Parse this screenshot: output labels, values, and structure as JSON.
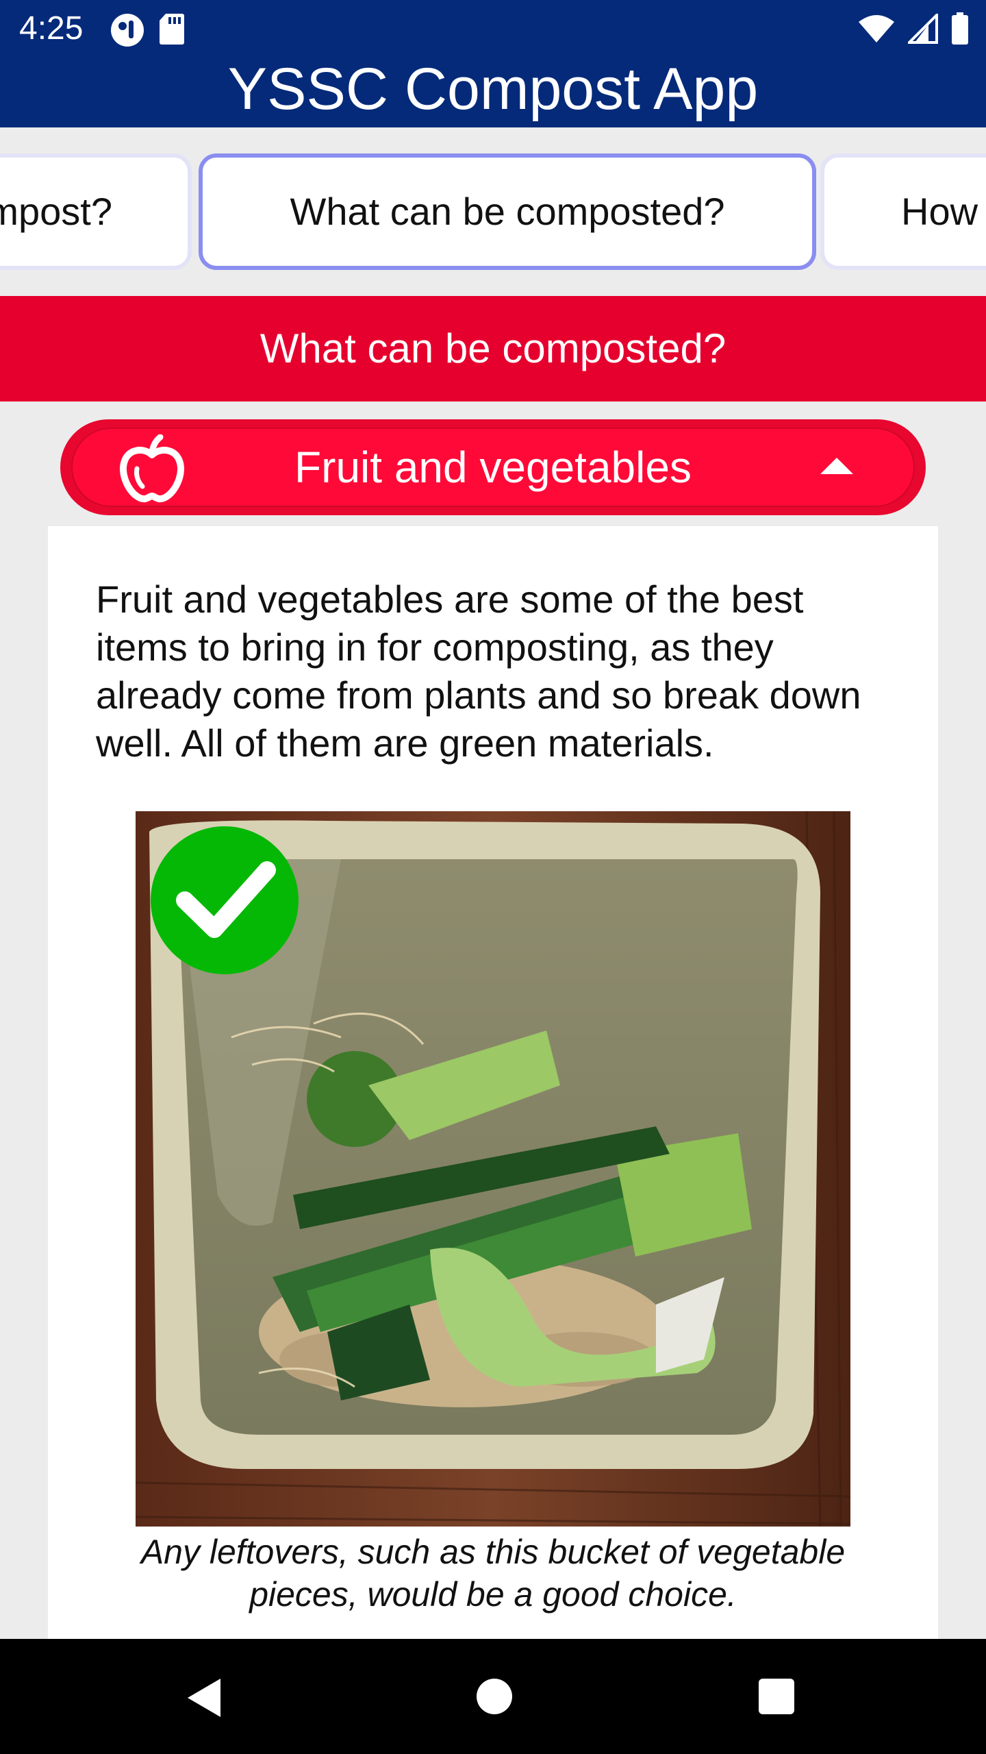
{
  "status_bar": {
    "time": "4:25",
    "icons_left": [
      "notification-icon",
      "sd-card-icon"
    ],
    "icons_right": [
      "wifi-icon",
      "cell-signal-icon",
      "battery-icon"
    ]
  },
  "app_bar": {
    "title": "YSSC Compost App",
    "color": "#052a7a"
  },
  "tabs": [
    {
      "label": "mpost?",
      "active": false
    },
    {
      "label": "What can be composted?",
      "active": true
    },
    {
      "label": "How",
      "active": false
    }
  ],
  "section": {
    "heading": "What can be composted?",
    "color": "#e6002e"
  },
  "accordion": {
    "icon": "apple-icon",
    "title": "Fruit and vegetables",
    "expanded": true,
    "toggle_icon": "caret-up-icon"
  },
  "content": {
    "body": "Fruit and vegetables are some of the best items to bring in for composting, as they already come from plants and so break down well. All of them are green materials.",
    "photo_badge_icon": "checkmark-icon",
    "caption": "Any leftovers, such as this bucket of vegetable pieces, would be a good choice."
  },
  "nav_bar": {
    "buttons": [
      "back-icon",
      "home-icon",
      "recents-icon"
    ]
  }
}
